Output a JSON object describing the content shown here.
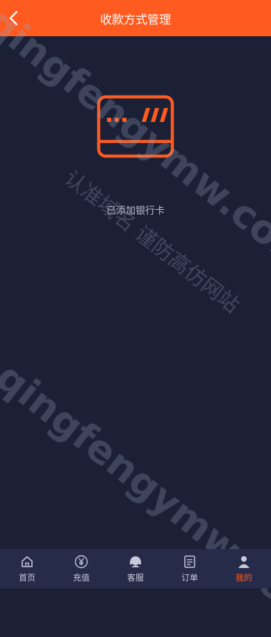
{
  "header": {
    "title": "收款方式管理"
  },
  "empty_state": {
    "text": "已添加银行卡"
  },
  "watermark": {
    "site": "qingfengymw.com",
    "slogan": "认准域名 谨防高仿网站"
  },
  "tabbar": {
    "items": [
      {
        "label": "首页",
        "icon": "home-icon"
      },
      {
        "label": "充值",
        "icon": "yen-icon"
      },
      {
        "label": "客服",
        "icon": "headset-icon"
      },
      {
        "label": "订单",
        "icon": "order-icon"
      },
      {
        "label": "我的",
        "icon": "user-icon",
        "active": true
      }
    ]
  },
  "colors": {
    "accent": "#ff5a1f",
    "background": "#1b2036",
    "tabbar": "#272b4a"
  }
}
